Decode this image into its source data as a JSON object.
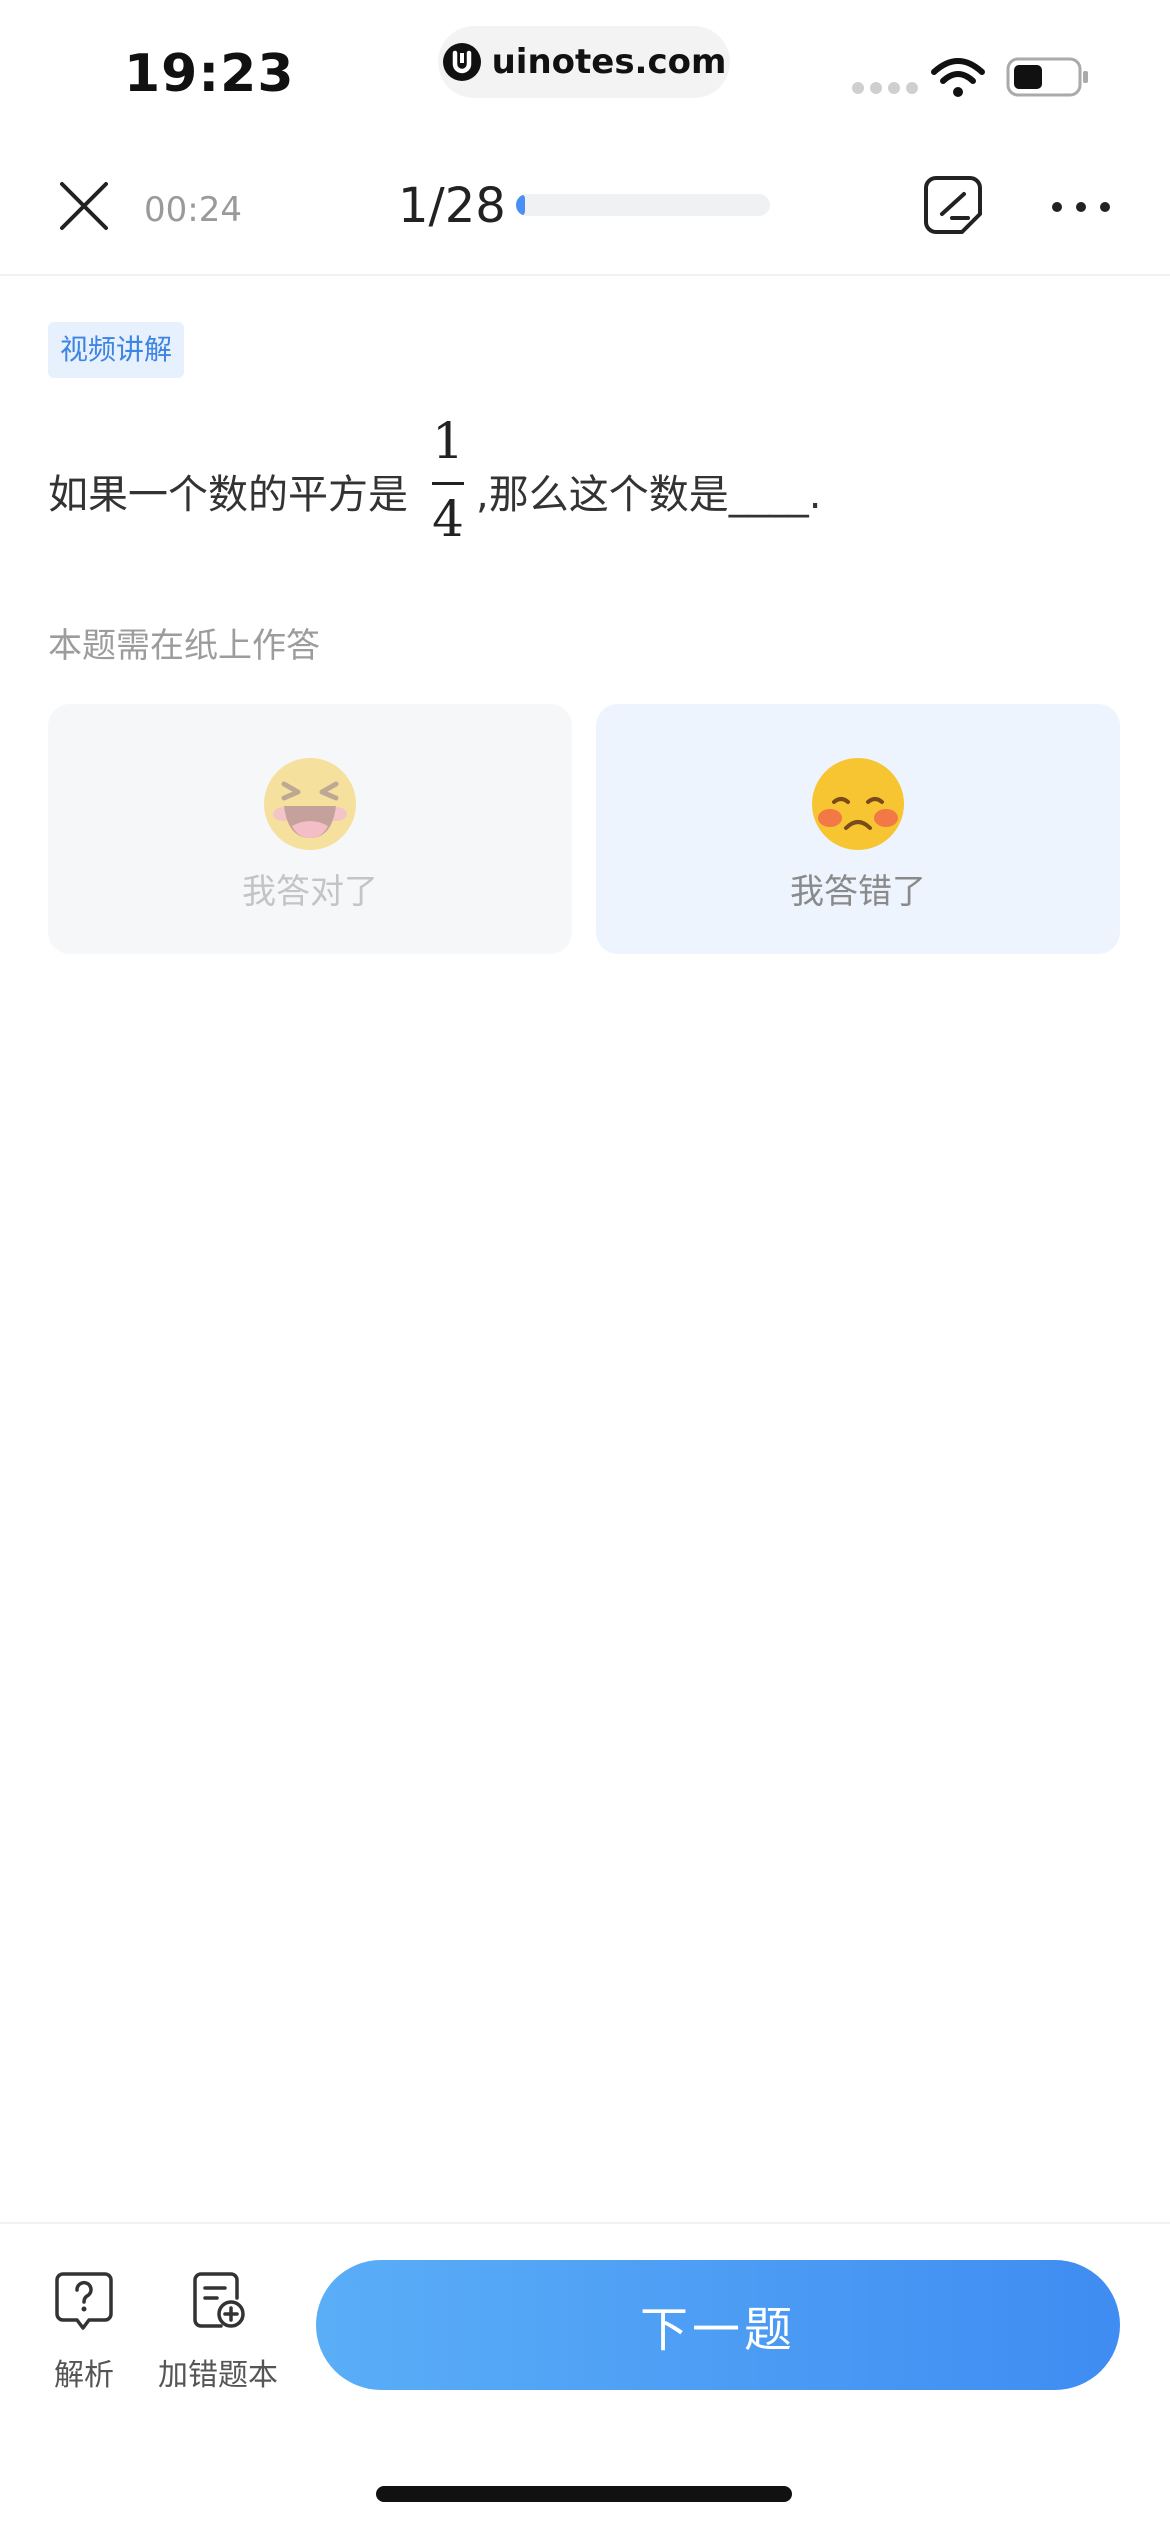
{
  "status_bar": {
    "time": "19:23",
    "url": "uinotes.com"
  },
  "toolbar": {
    "timer": "00:24",
    "progress_text": "1/28",
    "progress_fraction": 0.036
  },
  "question": {
    "tag": "视频讲解",
    "text_before": "如果一个数的平方是",
    "fraction_numerator": "1",
    "fraction_denominator": "4",
    "text_after": ",那么这个数是____.",
    "hint": "本题需在纸上作答"
  },
  "answers": {
    "correct_label": "我答对了",
    "wrong_label": "我答错了"
  },
  "bottom": {
    "analysis_label": "解析",
    "add_wrong_label": "加错题本",
    "next_label": "下一题"
  },
  "colors": {
    "accent": "#4a90f2",
    "tag_bg": "#e7f1fd",
    "wrong_card_bg": "#edf4fd",
    "correct_card_bg": "#f6f7f9"
  },
  "icons": {
    "close": "close-icon",
    "note": "note-edit-icon",
    "more": "more-icon",
    "analysis": "question-bubble-icon",
    "add_wrong": "add-to-notebook-icon",
    "correct_emoji": "laughing-emoji-icon",
    "wrong_emoji": "sad-emoji-icon"
  }
}
